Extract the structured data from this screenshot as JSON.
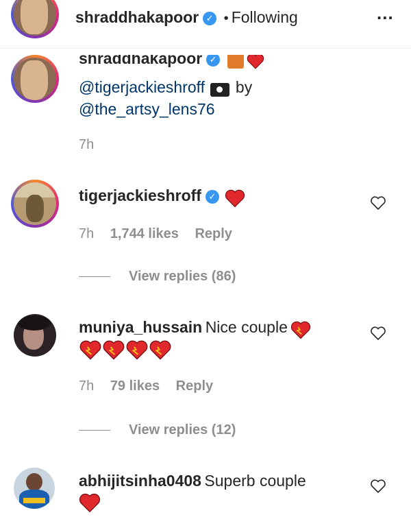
{
  "header": {
    "username": "shraddhakapoor",
    "separator": "•",
    "follow_status": "Following",
    "more_label": "..."
  },
  "caption": {
    "username": "shraddhakapoor",
    "mention1": "@tigerjackieshroff",
    "by_text": "by",
    "mention2": "@the_artsy_lens76",
    "time": "7h"
  },
  "comments": [
    {
      "username": "tigerjackieshroff",
      "text": "",
      "time": "7h",
      "likes": "1,744 likes",
      "reply": "Reply",
      "view_replies": "View replies (86)"
    },
    {
      "username": "muniya_hussain",
      "text": "Nice couple",
      "time": "7h",
      "likes": "79 likes",
      "reply": "Reply",
      "view_replies": "View replies (12)"
    },
    {
      "username": "abhijitsinha0408",
      "text": "Superb couple"
    }
  ],
  "colors": {
    "accent_blue": "#3897f0",
    "link": "#003569",
    "muted": "#8e8e8e",
    "heart_red": "#e0282d"
  }
}
